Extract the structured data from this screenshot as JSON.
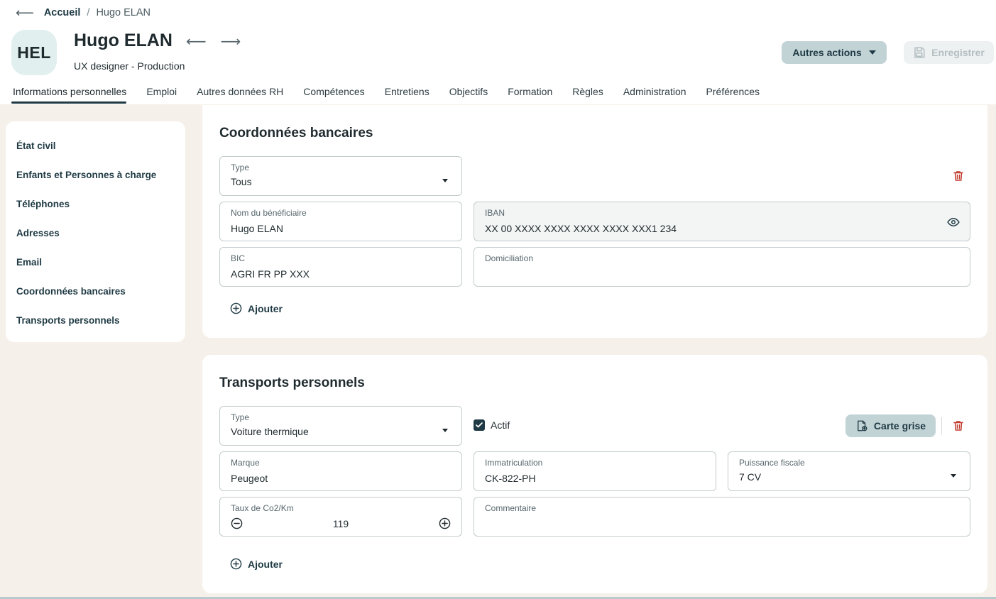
{
  "breadcrumb": {
    "home": "Accueil",
    "separator": "/",
    "current": "Hugo ELAN"
  },
  "employee": {
    "initials": "HEL",
    "name": "Hugo ELAN",
    "role": "UX designer - Production"
  },
  "header_actions": {
    "other_actions_label": "Autres actions",
    "save_label": "Enregistrer"
  },
  "tabs": [
    {
      "label": "Informations personnelles",
      "active": true
    },
    {
      "label": "Emploi"
    },
    {
      "label": "Autres données RH"
    },
    {
      "label": "Compétences"
    },
    {
      "label": "Entretiens"
    },
    {
      "label": "Objectifs"
    },
    {
      "label": "Formation"
    },
    {
      "label": "Règles"
    },
    {
      "label": "Administration"
    },
    {
      "label": "Préférences"
    }
  ],
  "sidebar": {
    "items": [
      {
        "label": "État civil"
      },
      {
        "label": "Enfants et Personnes à charge"
      },
      {
        "label": "Téléphones"
      },
      {
        "label": "Adresses"
      },
      {
        "label": "Email"
      },
      {
        "label": "Coordonnées bancaires"
      },
      {
        "label": "Transports personnels"
      }
    ]
  },
  "bank": {
    "title": "Coordonnées bancaires",
    "type": {
      "label": "Type",
      "value": "Tous"
    },
    "beneficiary": {
      "label": "Nom du bénéficiaire",
      "value": "Hugo ELAN"
    },
    "iban": {
      "label": "IBAN",
      "value": "XX 00 XXXX XXXX XXXX XXXX XXX1 234"
    },
    "bic": {
      "label": "BIC",
      "value": "AGRI FR PP XXX"
    },
    "domiciliation": {
      "label": "Domiciliation",
      "value": ""
    },
    "add_label": "Ajouter"
  },
  "transport": {
    "title": "Transports personnels",
    "type": {
      "label": "Type",
      "value": "Voiture thermique"
    },
    "active": {
      "label": "Actif",
      "checked": true
    },
    "carte_grise_label": "Carte grise",
    "brand": {
      "label": "Marque",
      "value": "Peugeot"
    },
    "plate": {
      "label": "Immatriculation",
      "value": "CK-822-PH"
    },
    "power": {
      "label": "Puissance fiscale",
      "value": "7 CV"
    },
    "co2": {
      "label": "Taux de Co2/Km",
      "value": "119"
    },
    "comment": {
      "label": "Commentaire",
      "value": ""
    },
    "add_label": "Ajouter"
  },
  "colors": {
    "primary": "#1f3a44",
    "danger": "#c0392b",
    "background": "#f5f1ea",
    "tonal_button": "#c2d3d6"
  }
}
